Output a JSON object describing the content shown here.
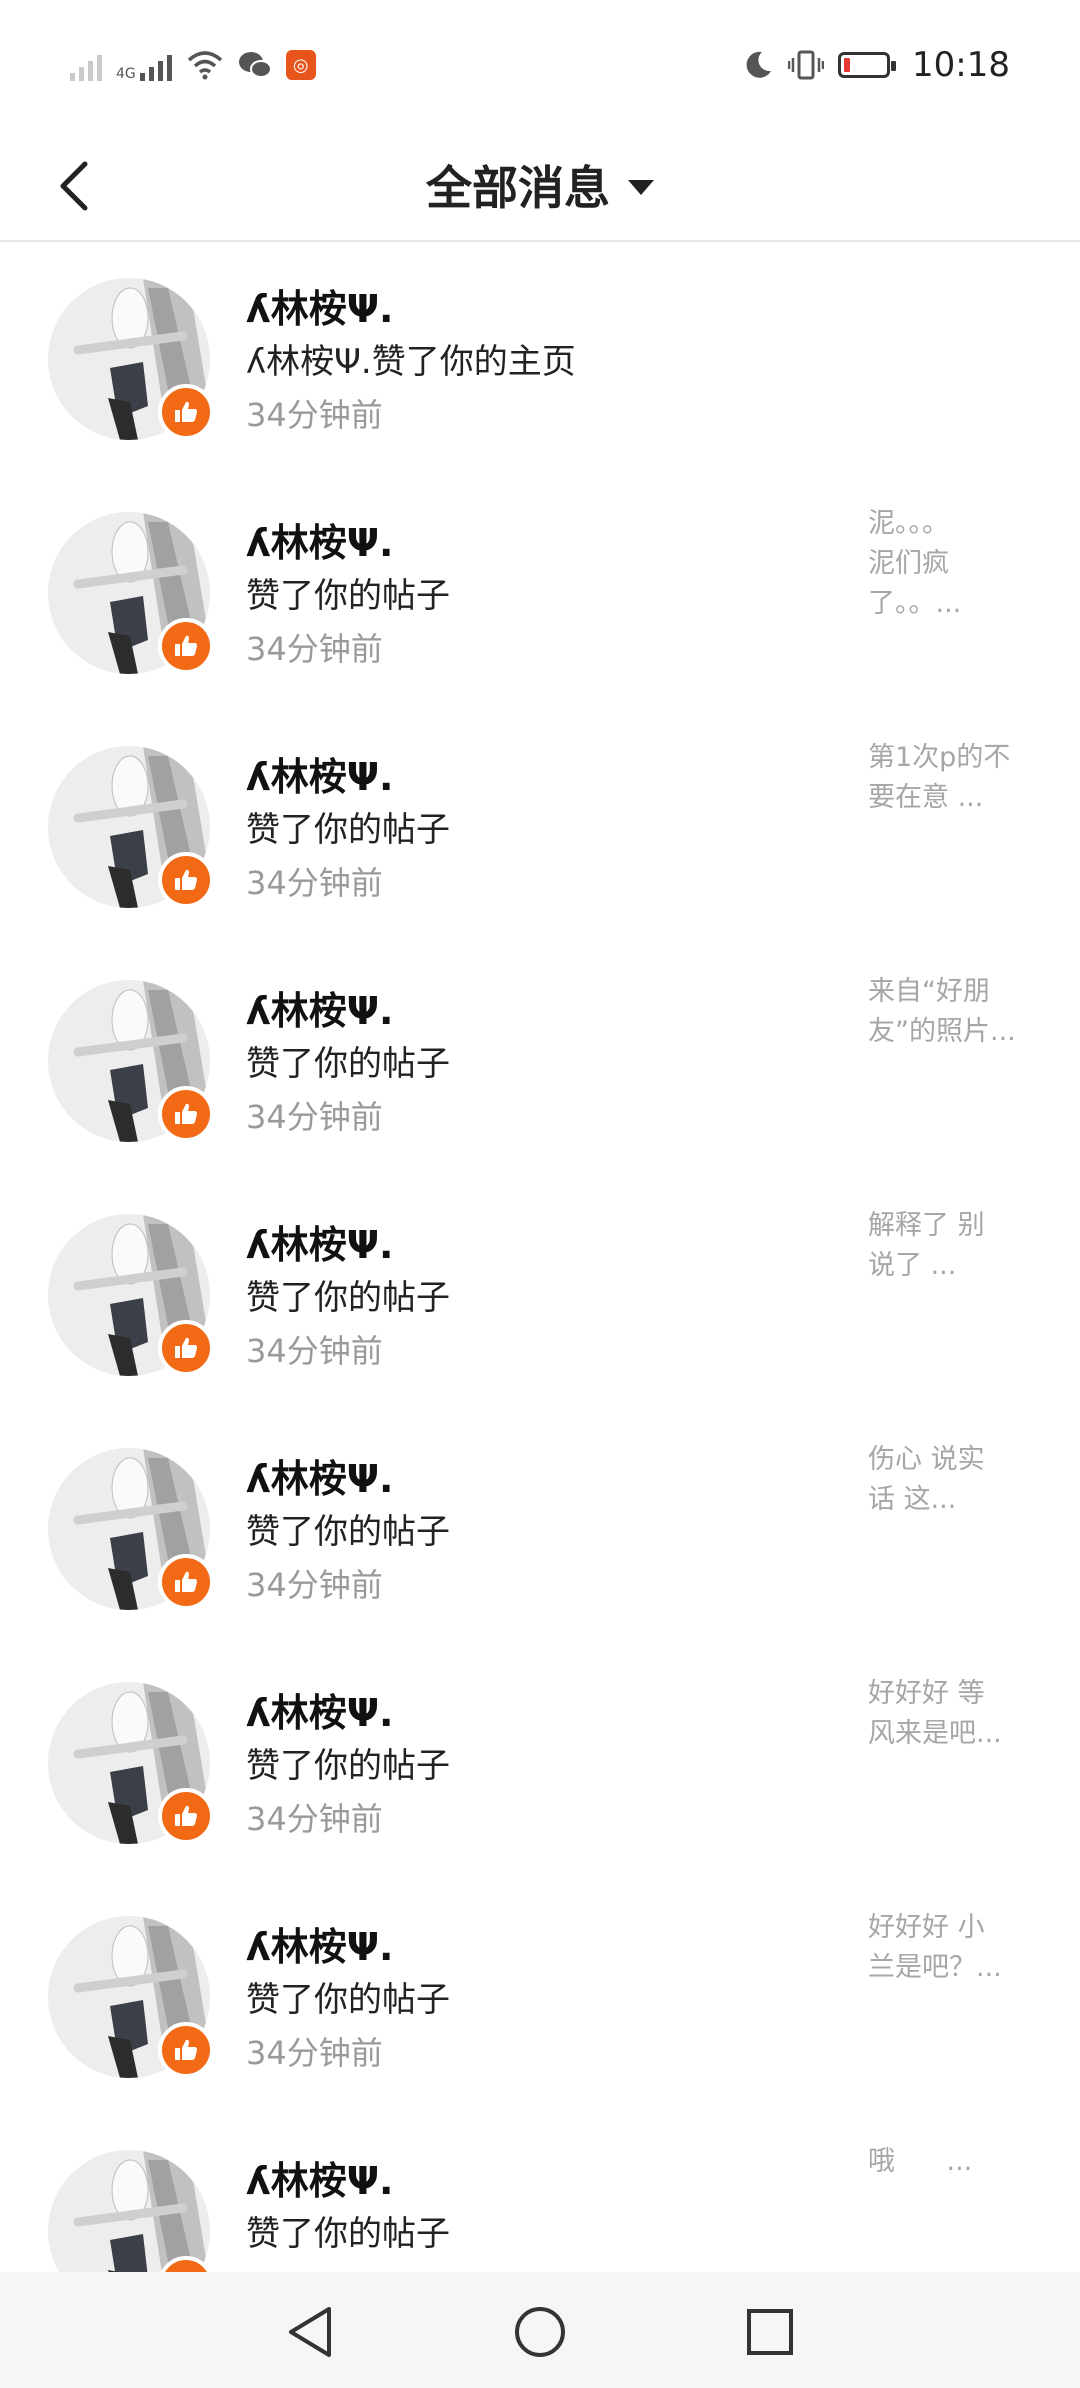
{
  "status_bar": {
    "net_label": "4G",
    "time": "10:18",
    "icons": [
      "no-sim-signal-icon",
      "signal-4g-icon",
      "wifi-icon",
      "wechat-icon",
      "app-notification-icon",
      "do-not-disturb-moon-icon",
      "vibrate-icon",
      "battery-low-icon"
    ],
    "battery_color": "#e53935"
  },
  "header": {
    "title": "全部消息",
    "back_icon": "chevron-left-icon",
    "dropdown_icon": "caret-down-icon"
  },
  "accent_color": "#f26a16",
  "messages": [
    {
      "name": "ʎ林桉Ψ.",
      "action": "ʎ林桉Ψ.赞了你的主页",
      "time": "34分钟前",
      "preview": ""
    },
    {
      "name": "ʎ林桉Ψ.",
      "action": "赞了你的帖子",
      "time": "34分钟前",
      "preview": "泥。。。\n泥们疯\n了。。..."
    },
    {
      "name": "ʎ林桉Ψ.",
      "action": "赞了你的帖子",
      "time": "34分钟前",
      "preview": "第1次p的不\n要在意 ..."
    },
    {
      "name": "ʎ林桉Ψ.",
      "action": "赞了你的帖子",
      "time": "34分钟前",
      "preview": "来自“好朋\n友”的照片..."
    },
    {
      "name": "ʎ林桉Ψ.",
      "action": "赞了你的帖子",
      "time": "34分钟前",
      "preview": "解释了 别\n说了 ..."
    },
    {
      "name": "ʎ林桉Ψ.",
      "action": "赞了你的帖子",
      "time": "34分钟前",
      "preview": "伤心 说实\n话 这..."
    },
    {
      "name": "ʎ林桉Ψ.",
      "action": "赞了你的帖子",
      "time": "34分钟前",
      "preview": "好好好 等\n风来是吧..."
    },
    {
      "name": "ʎ林桉Ψ.",
      "action": "赞了你的帖子",
      "time": "34分钟前",
      "preview": "好好好 小\n兰是吧？..."
    },
    {
      "name": "ʎ林桉Ψ.",
      "action": "赞了你的帖子",
      "time": "",
      "preview": "哦      ..."
    }
  ],
  "nav_bar": {
    "buttons": [
      "back-triangle-icon",
      "home-circle-icon",
      "recents-square-icon"
    ]
  }
}
